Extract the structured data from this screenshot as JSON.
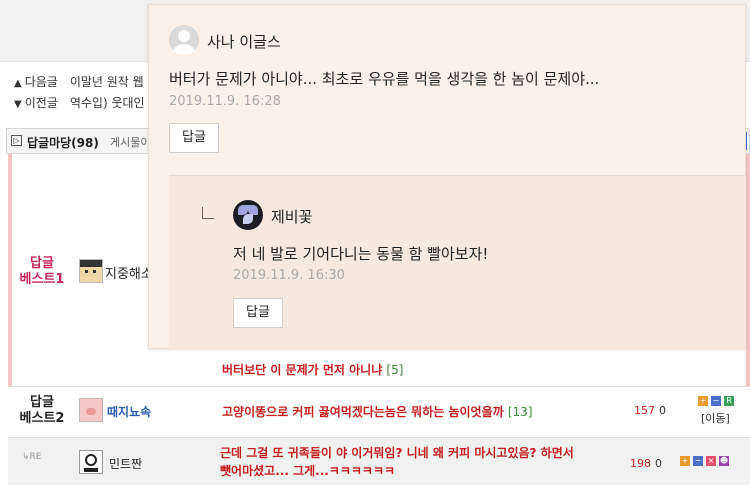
{
  "nav": {
    "next_label": "다음글",
    "next_title": "이말년 원작 웹",
    "prev_label": "이전글",
    "prev_title": "역수입) 웃대인"
  },
  "replies": {
    "header_title": "답글마당",
    "header_count": "(98)",
    "header_note": "게시물이 기"
  },
  "rows": [
    {
      "label_line1": "답글",
      "label_line2": "베스트1",
      "nick": "지중해소",
      "comment": "버터보단 이 문제가 먼저 아니냐",
      "count": "[5]"
    },
    {
      "label_line1": "답글",
      "label_line2": "베스트2",
      "nick": "때지뇨속",
      "comment": "고양이똥으로 커피 끓여먹겠다는놈은 뭐하는 놈이엇을까",
      "count": "[13]",
      "recommend": "157",
      "oppose": "0",
      "move_label": "[이동]"
    },
    {
      "re_label": "RE",
      "nick": "민트짠",
      "comment_line1": "근데 그걸 또 귀족들이 야 이거뭐임? 니네 왜 커피 마시고있음? 하면서",
      "comment_line2": "뺏어마셨고... 그게...ㅋㅋㅋㅋㅋㅋ",
      "recommend": "198",
      "oppose": "0"
    }
  ],
  "popup": {
    "author": "사나 이글스",
    "text": "버터가 문제가 아니야... 최초로 우유를 먹을 생각을 한 놈이 문제야...",
    "date": "2019.11.9. 16:28",
    "reply_label": "답글",
    "nested": {
      "author": "제비꽃",
      "text": "저 네 발로 기어다니는 동물 함 빨아보자!",
      "date": "2019.11.9. 16:30",
      "reply_label": "답글"
    }
  },
  "colors": {
    "best_label": "#c3265a",
    "comment_red": "#c41e1e",
    "popup_bg": "#fcf1e8",
    "popup_nested_bg": "#f7e9dd",
    "best_border": "#f4c3c3"
  },
  "icons": {
    "user_avatar": "user-silhouette-icon",
    "violet_avatar": "violet-flower-icon",
    "reply_hook": "reply-hook-icon"
  }
}
